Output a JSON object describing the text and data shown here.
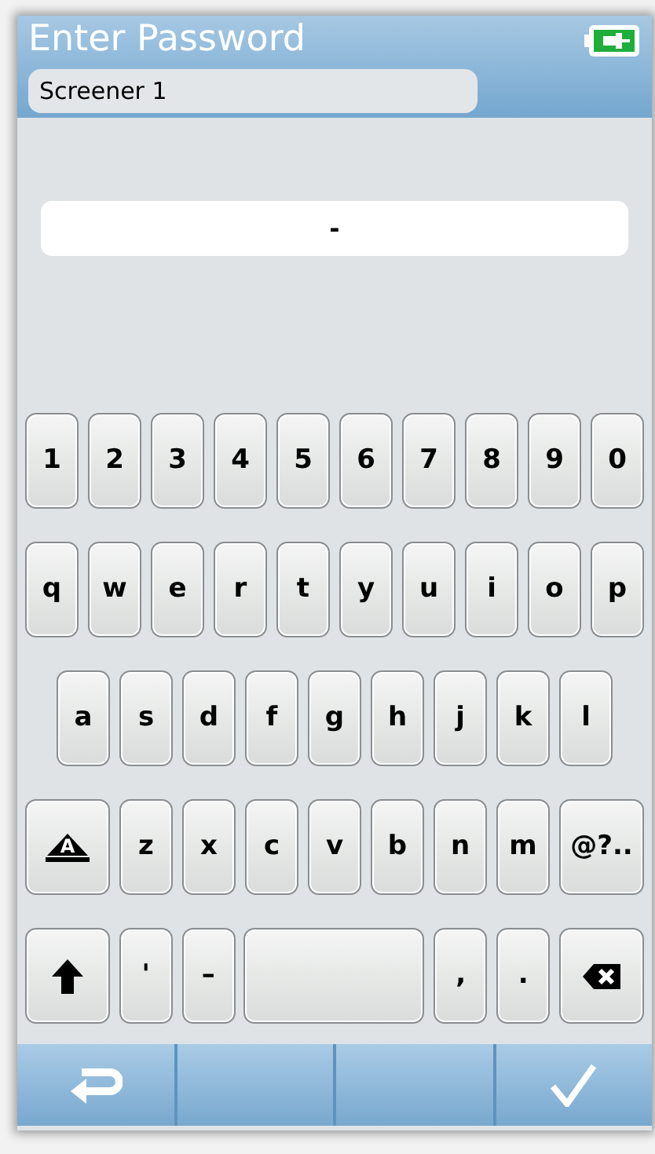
{
  "header": {
    "title": "Enter Password",
    "user": "Screener 1"
  },
  "password_field": {
    "value": "-"
  },
  "keyboard": [
    [
      {
        "kind": "char",
        "label": "1"
      },
      {
        "kind": "char",
        "label": "2"
      },
      {
        "kind": "char",
        "label": "3"
      },
      {
        "kind": "char",
        "label": "4"
      },
      {
        "kind": "char",
        "label": "5"
      },
      {
        "kind": "char",
        "label": "6"
      },
      {
        "kind": "char",
        "label": "7"
      },
      {
        "kind": "char",
        "label": "8"
      },
      {
        "kind": "char",
        "label": "9"
      },
      {
        "kind": "char",
        "label": "0"
      }
    ],
    [
      {
        "kind": "char",
        "label": "q"
      },
      {
        "kind": "char",
        "label": "w"
      },
      {
        "kind": "char",
        "label": "e"
      },
      {
        "kind": "char",
        "label": "r"
      },
      {
        "kind": "char",
        "label": "t"
      },
      {
        "kind": "char",
        "label": "y"
      },
      {
        "kind": "char",
        "label": "u"
      },
      {
        "kind": "char",
        "label": "i"
      },
      {
        "kind": "char",
        "label": "o"
      },
      {
        "kind": "char",
        "label": "p"
      }
    ],
    [
      {
        "kind": "char",
        "label": "a"
      },
      {
        "kind": "char",
        "label": "s"
      },
      {
        "kind": "char",
        "label": "d"
      },
      {
        "kind": "char",
        "label": "f"
      },
      {
        "kind": "char",
        "label": "g"
      },
      {
        "kind": "char",
        "label": "h"
      },
      {
        "kind": "char",
        "label": "j"
      },
      {
        "kind": "char",
        "label": "k"
      },
      {
        "kind": "char",
        "label": "l"
      }
    ],
    [
      {
        "kind": "caps",
        "label": "A"
      },
      {
        "kind": "char",
        "label": "z"
      },
      {
        "kind": "char",
        "label": "x"
      },
      {
        "kind": "char",
        "label": "c"
      },
      {
        "kind": "char",
        "label": "v"
      },
      {
        "kind": "char",
        "label": "b"
      },
      {
        "kind": "char",
        "label": "n"
      },
      {
        "kind": "char",
        "label": "m"
      },
      {
        "kind": "wide",
        "label": "@?.."
      }
    ],
    [
      {
        "kind": "shift"
      },
      {
        "kind": "char",
        "label": "'"
      },
      {
        "kind": "char",
        "label": "–"
      },
      {
        "kind": "space"
      },
      {
        "kind": "char",
        "label": ","
      },
      {
        "kind": "char",
        "label": "."
      },
      {
        "kind": "backspace"
      }
    ]
  ],
  "bottom_bar": [
    {
      "kind": "back"
    },
    {
      "kind": "empty"
    },
    {
      "kind": "empty"
    },
    {
      "kind": "confirm"
    }
  ]
}
